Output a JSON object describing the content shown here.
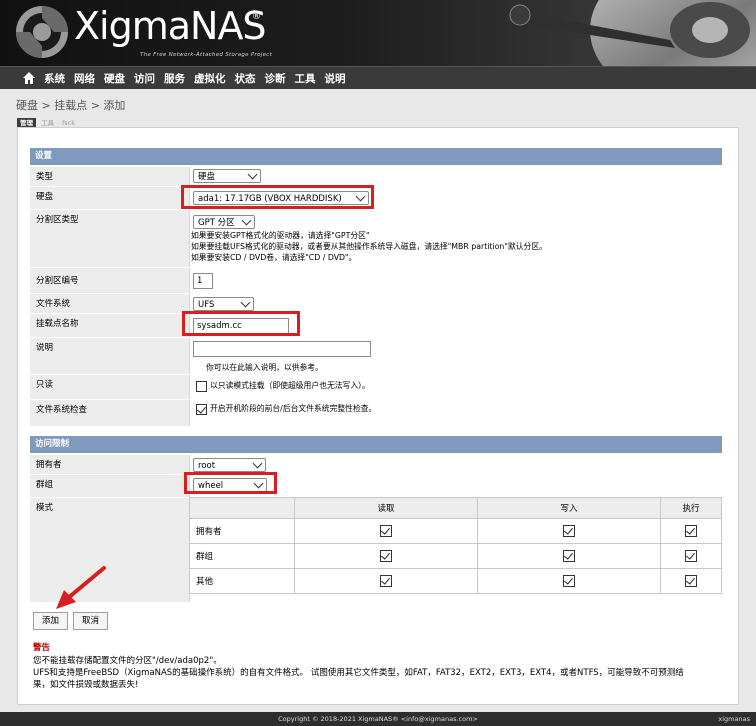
{
  "brand": {
    "name": "XigmaNAS",
    "reg": "®",
    "tagline": "The Free Network-Attached Storage Project"
  },
  "nav": {
    "items": [
      "系统",
      "网络",
      "硬盘",
      "访问",
      "服务",
      "虚拟化",
      "状态",
      "诊断",
      "工具",
      "说明"
    ]
  },
  "breadcrumb": "硬盘 > 挂载点 > 添加",
  "tabs": [
    "管理",
    "工具",
    "fsck"
  ],
  "settings": {
    "title": "设置",
    "type": {
      "label": "类型",
      "value": "硬盘"
    },
    "disk": {
      "label": "硬盘",
      "value": "ada1: 17.17GB (VBOX HARDDISK)"
    },
    "partition_type": {
      "label": "分割区类型",
      "value": "GPT 分区",
      "hint1": "如果要安装GPT格式化的驱动器，请选择\"GPT分区\"",
      "hint2": "如果要挂载UFS格式化的驱动器，或者要从其他操作系统导入磁盘，请选择\"MBR partition\"默认分区。",
      "hint3": "如果要安装CD / DVD卷，请选择\"CD / DVD\"。"
    },
    "partition_number": {
      "label": "分割区编号",
      "value": "1"
    },
    "filesystem": {
      "label": "文件系统",
      "value": "UFS"
    },
    "mount_name": {
      "label": "挂载点名称",
      "value": "sysadm.cc"
    },
    "description": {
      "label": "说明",
      "value": "",
      "hint": "你可以在此输入说明，以供参考。"
    },
    "readonly": {
      "label": "只读",
      "text": "以只读模式挂载（即使超级用户也无法写入）。",
      "checked": false
    },
    "fsck": {
      "label": "文件系统检查",
      "text": "开启开机阶段的前台/后台文件系统完整性检查。",
      "checked": true
    }
  },
  "access": {
    "title": "访问限制",
    "owner": {
      "label": "拥有者",
      "value": "root"
    },
    "group": {
      "label": "群组",
      "value": "wheel"
    },
    "mode": {
      "label": "模式",
      "columns": [
        "读取",
        "写入",
        "执行"
      ],
      "rows": [
        {
          "label": "拥有者",
          "read": true,
          "write": true,
          "exec": true
        },
        {
          "label": "群组",
          "read": true,
          "write": true,
          "exec": true
        },
        {
          "label": "其他",
          "read": true,
          "write": true,
          "exec": true
        }
      ]
    }
  },
  "buttons": {
    "add": "添加",
    "cancel": "取消"
  },
  "warning": {
    "title": "警告",
    "line1": "您不能挂载存储配置文件的分区\"/dev/ada0p2\"。",
    "line2": "UFS和支持是FreeBSD（XigmaNAS的基础操作系统）的自有文件格式。 试图使用其它文件类型，如FAT，FAT32，EXT2，EXT3，EXT4，或者NTFS，可能导致不可预测结",
    "line3": "果，如文件损毁或数据丢失!"
  },
  "footer": {
    "copyright": "Copyright © 2018-2021 XigmaNAS® <info@xigmanas.com>",
    "host": "xigmanas"
  },
  "colors": {
    "section_header": "#7f9abd",
    "highlight": "#d81e1e",
    "warning": "#c00000"
  }
}
